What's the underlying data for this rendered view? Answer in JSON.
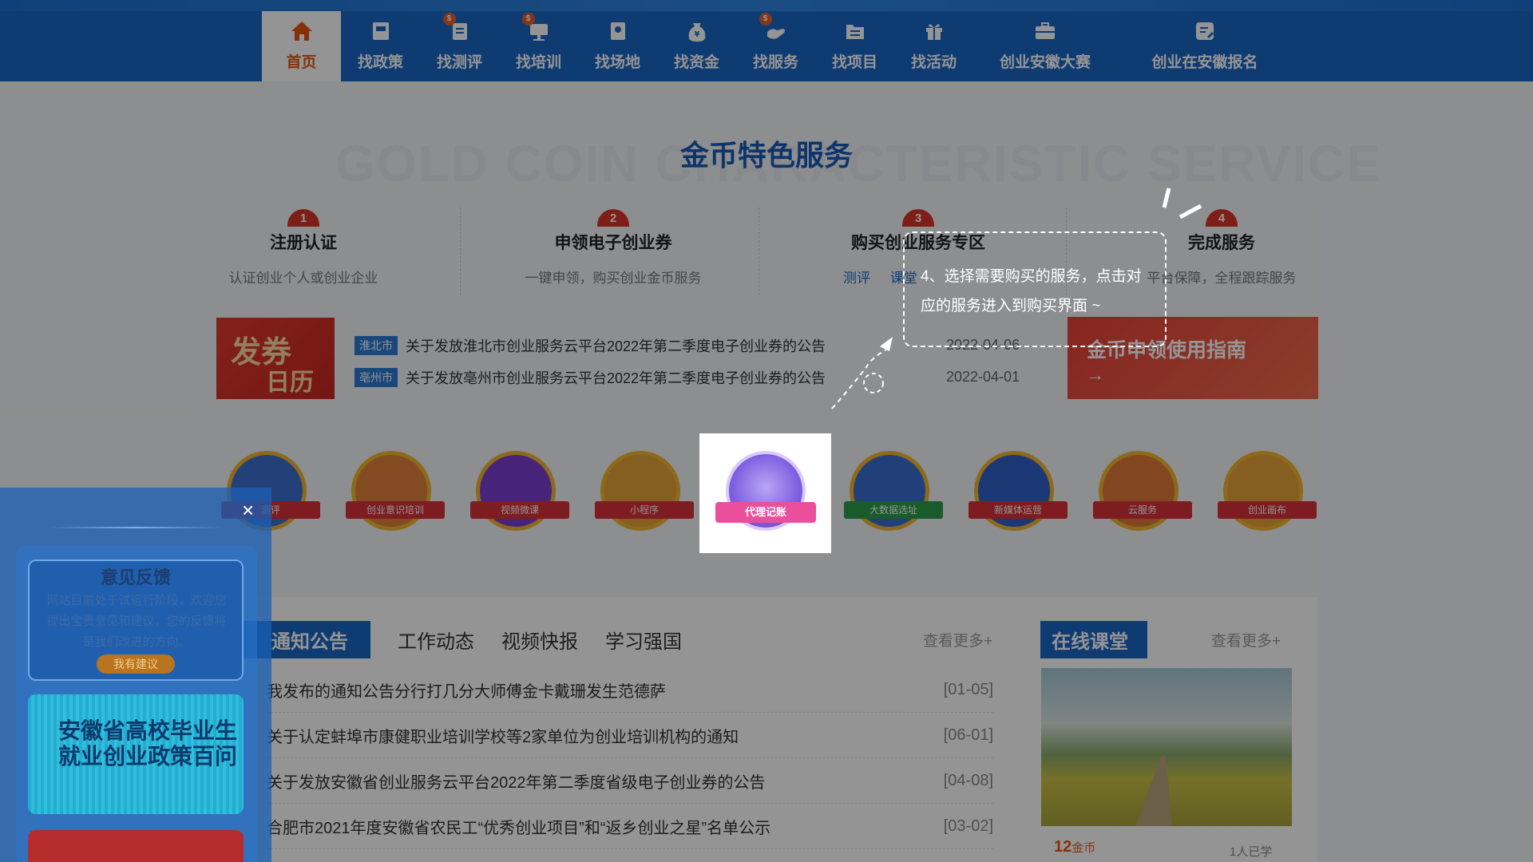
{
  "nav": {
    "items": [
      {
        "label": "首页",
        "icon": "home-icon",
        "active": true
      },
      {
        "label": "找政策",
        "icon": "policy-icon"
      },
      {
        "label": "找测评",
        "icon": "assessment-icon",
        "badge": true
      },
      {
        "label": "找培训",
        "icon": "training-icon",
        "badge": true
      },
      {
        "label": "找场地",
        "icon": "venue-icon"
      },
      {
        "label": "找资金",
        "icon": "funding-icon"
      },
      {
        "label": "找服务",
        "icon": "service-icon",
        "badge": true
      },
      {
        "label": "找项目",
        "icon": "project-icon"
      },
      {
        "label": "找活动",
        "icon": "gift-icon"
      },
      {
        "label": "创业安徽大赛",
        "icon": "briefcase-icon"
      },
      {
        "label": "创业在安徽报名",
        "icon": "signup-icon"
      }
    ]
  },
  "gold": {
    "title": "金币特色服务",
    "bg_text": "GOLD COIN CHARACTERISTIC SERVICE",
    "steps": [
      {
        "num": "1",
        "title": "注册认证",
        "desc": "认证创业个人或创业企业"
      },
      {
        "num": "2",
        "title": "申领电子创业券",
        "desc": "一键申领，购买创业金币服务"
      },
      {
        "num": "3",
        "title": "购买创业服务专区",
        "links": [
          "测评",
          "课堂"
        ]
      },
      {
        "num": "4",
        "title": "完成服务",
        "desc": "平台保障，全程跟踪服务"
      }
    ],
    "calendar": {
      "line1": "发券",
      "line2": "日历"
    },
    "notices": [
      {
        "city": "淮北市",
        "text": "关于发放淮北市创业服务云平台2022年第二季度电子创业券的公告",
        "date": "2022-04-06"
      },
      {
        "city": "亳州市",
        "text": "关于发放亳州市创业服务云平台2022年第二季度电子创业券的公告",
        "date": "2022-04-01"
      }
    ],
    "guide": {
      "title": "金币申领使用指南",
      "arrow": "→"
    },
    "services": [
      "测评",
      "创业意识培训",
      "视频微课",
      "小程序",
      "代理记账",
      "大数据选址",
      "新媒体运营",
      "云服务",
      "创业画布"
    ]
  },
  "tooltip": {
    "text": "4、选择需要购买的服务，点击对应的服务进入到购买界面 ~"
  },
  "highlight": {
    "label": "代理记账"
  },
  "news": {
    "tabs": [
      "通知公告",
      "工作动态",
      "视频快报",
      "学习强国"
    ],
    "more": "查看更多+",
    "rows": [
      {
        "text": "我发布的通知公告分行打几分大师傅金卡戴珊发生范德萨",
        "date": "[01-05]"
      },
      {
        "text": "关于认定蚌埠市康健职业培训学校等2家单位为创业培训机构的通知",
        "date": "[06-01]"
      },
      {
        "text": "关于发放安徽省创业服务云平台2022年第二季度省级电子创业券的公告",
        "date": "[04-08]"
      },
      {
        "text": "合肥市2021年度安徽省农民工“优秀创业项目”和“返乡创业之星”名单公示",
        "date": "[03-02]"
      }
    ]
  },
  "course": {
    "tab": "在线课堂",
    "more": "查看更多+",
    "coins": "12",
    "coins_unit": "金币",
    "learners": "1人已学"
  },
  "feedback": {
    "close": "×",
    "title": "意见反馈",
    "text": "网站目前处于试运行阶段，欢迎您提出宝贵意见和建议，您的反馈将是我们改进的方向。",
    "button": "我有建议",
    "poster": "安徽省高校毕业生就业创业政策百问"
  }
}
